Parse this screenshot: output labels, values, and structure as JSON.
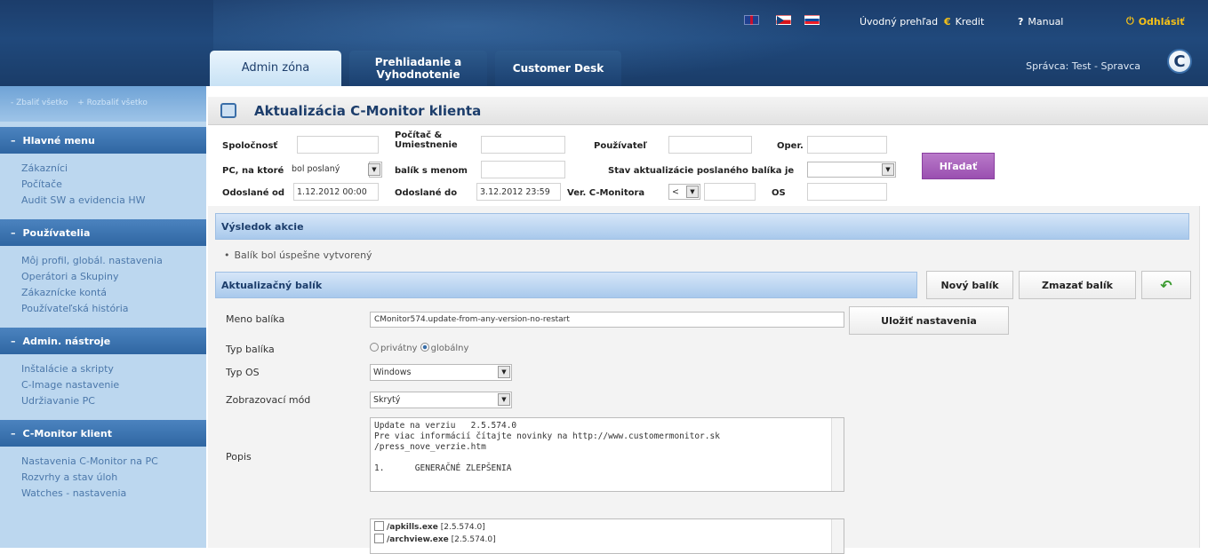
{
  "header": {
    "nav_home": "Úvodný prehľad",
    "nav_credit": "Kredit",
    "nav_manual": "Manual",
    "nav_logout": "Odhlásiť",
    "admin_info": "Správca: Test - Spravca",
    "logo_letter": "C",
    "tabs": [
      {
        "label": "Admin zóna",
        "active": true
      },
      {
        "label": "Prehliadanie a Vyhodnotenie",
        "active": false
      },
      {
        "label": "Customer Desk",
        "active": false
      }
    ],
    "flags": [
      "flag-uk-icon",
      "flag-cz-icon",
      "flag-sk-icon"
    ]
  },
  "sidebar": {
    "collapse_all": "- Zbaliť všetko",
    "expand_all": "+ Rozbaliť všetko",
    "sections": [
      {
        "title": "Hlavné menu",
        "items": [
          "Zákazníci",
          "Počítače",
          "Audit SW a evidencia HW"
        ]
      },
      {
        "title": "Používatelia",
        "items": [
          "Môj profil, globál. nastavenia",
          "Operátori a Skupiny",
          "Zákaznícke kontá",
          "Používateľská história"
        ]
      },
      {
        "title": "Admin. nástroje",
        "items": [
          "Inštalácie a skripty",
          "C-Image nastavenie",
          "Udržiavanie PC"
        ]
      },
      {
        "title": "C-Monitor klient",
        "items": [
          "Nastavenia C-Monitor na PC",
          "Rozvrhy a stav úloh",
          "Watches - nastavenia"
        ]
      }
    ]
  },
  "page": {
    "title": "Aktualizácia C-Monitor klienta"
  },
  "filter": {
    "company_label": "Spoločnosť",
    "computer_label": "Počítač & Umiestnenie",
    "user_label": "Používateľ",
    "oper_label": "Oper.",
    "pc_sent_label": "PC, na ktoré",
    "pc_sent_value": "bol poslaný",
    "package_name_label": "balík s menom",
    "status_label": "Stav aktualizácie poslaného balíka je",
    "sent_from_label": "Odoslané od",
    "sent_from_value": "1.12.2012 00:00",
    "sent_to_label": "Odoslané do",
    "sent_to_value": "3.12.2012 23:59",
    "version_label": "Ver. C-Monitora",
    "version_op": "<",
    "os_label": "OS",
    "search_button": "Hľadať"
  },
  "result": {
    "section_title": "Výsledok akcie",
    "message": "Balík bol úspešne vytvorený"
  },
  "package": {
    "section_title": "Aktualizačný balík",
    "new_button": "Nový balík",
    "delete_button": "Zmazať balík",
    "save_button": "Uložiť nastavenia",
    "name_label": "Meno balíka",
    "name_value": "CMonitor574.update-from-any-version-no-restart",
    "type_label": "Typ balíka",
    "type_private": "privátny",
    "type_global": "globálny",
    "os_label": "Typ OS",
    "os_value": "Windows",
    "display_label": "Zobrazovací mód",
    "display_value": "Skrytý",
    "desc_label": "Popis",
    "desc_text": "Update na verziu   2.5.574.0\nPre viac informácií čítajte novinky na http://www.customermonitor.sk\n/press_nove_verzie.htm\n\n1.      GENERAČNÉ ZLEPŠENIA",
    "files": [
      {
        "name": "/apkills.exe",
        "version": "[2.5.574.0]"
      },
      {
        "name": "/archview.exe",
        "version": "[2.5.574.0]"
      }
    ]
  }
}
